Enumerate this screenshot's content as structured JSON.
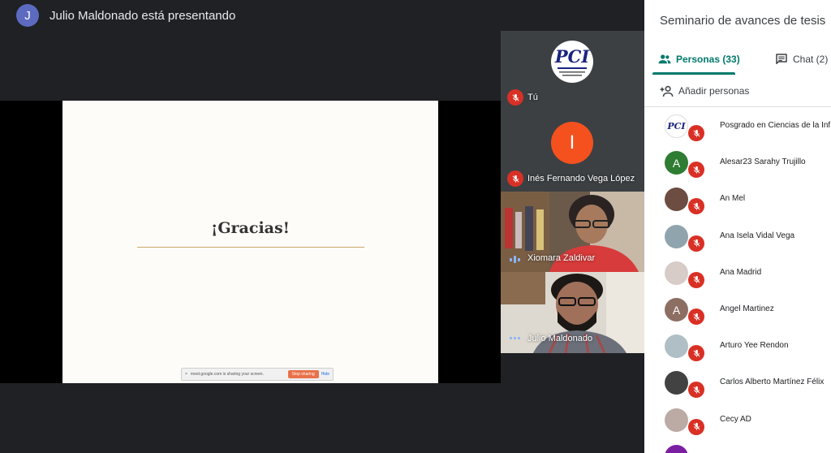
{
  "presenter": {
    "avatar_letter": "J",
    "title": "Julio Maldonado está presentando"
  },
  "slide": {
    "title": "¡Gracias!",
    "share_bar": {
      "close": "×",
      "text": "meet.google.com is sharing your screen.",
      "stop": "Stop sharing",
      "hide": "Hide"
    }
  },
  "tiles": [
    {
      "name": "Tú",
      "logo_text": "PCI"
    },
    {
      "name": "Inés Fernando Vega López",
      "letter": "I"
    },
    {
      "name": "Xiomara Zaldivar"
    },
    {
      "name": "Julio Maldonado"
    }
  ],
  "panel": {
    "title": "Seminario de avances de tesis",
    "tab_people": "Personas (33)",
    "tab_chat": "Chat (2)",
    "add_people": "Añadir personas",
    "participants": [
      {
        "name": "Posgrado en Ciencias de la Información",
        "avatar": "PCI",
        "color": "#ffffff"
      },
      {
        "name": "Alesar23 Sarahy Trujillo",
        "avatar": "A",
        "color": "#2e7d32"
      },
      {
        "name": "An Mel",
        "avatar": "",
        "color": "#6d4c41"
      },
      {
        "name": "Ana Isela Vidal Vega",
        "avatar": "",
        "color": "#90a4ae"
      },
      {
        "name": "Ana Madrid",
        "avatar": "",
        "color": "#d7ccc8"
      },
      {
        "name": "Angel Martinez",
        "avatar": "A",
        "color": "#8d6e63"
      },
      {
        "name": "Arturo Yee Rendon",
        "avatar": "",
        "color": "#b0bec5"
      },
      {
        "name": "Carlos Alberto Martínez Félix",
        "avatar": "",
        "color": "#424242"
      },
      {
        "name": "Cecy AD",
        "avatar": "",
        "color": "#bcaaa4"
      },
      {
        "name": "",
        "avatar": "",
        "color": "#7b1fa2"
      }
    ]
  },
  "colors": {
    "mic_off": "#d93025",
    "accent": "#00796b",
    "bg": "#202124"
  }
}
